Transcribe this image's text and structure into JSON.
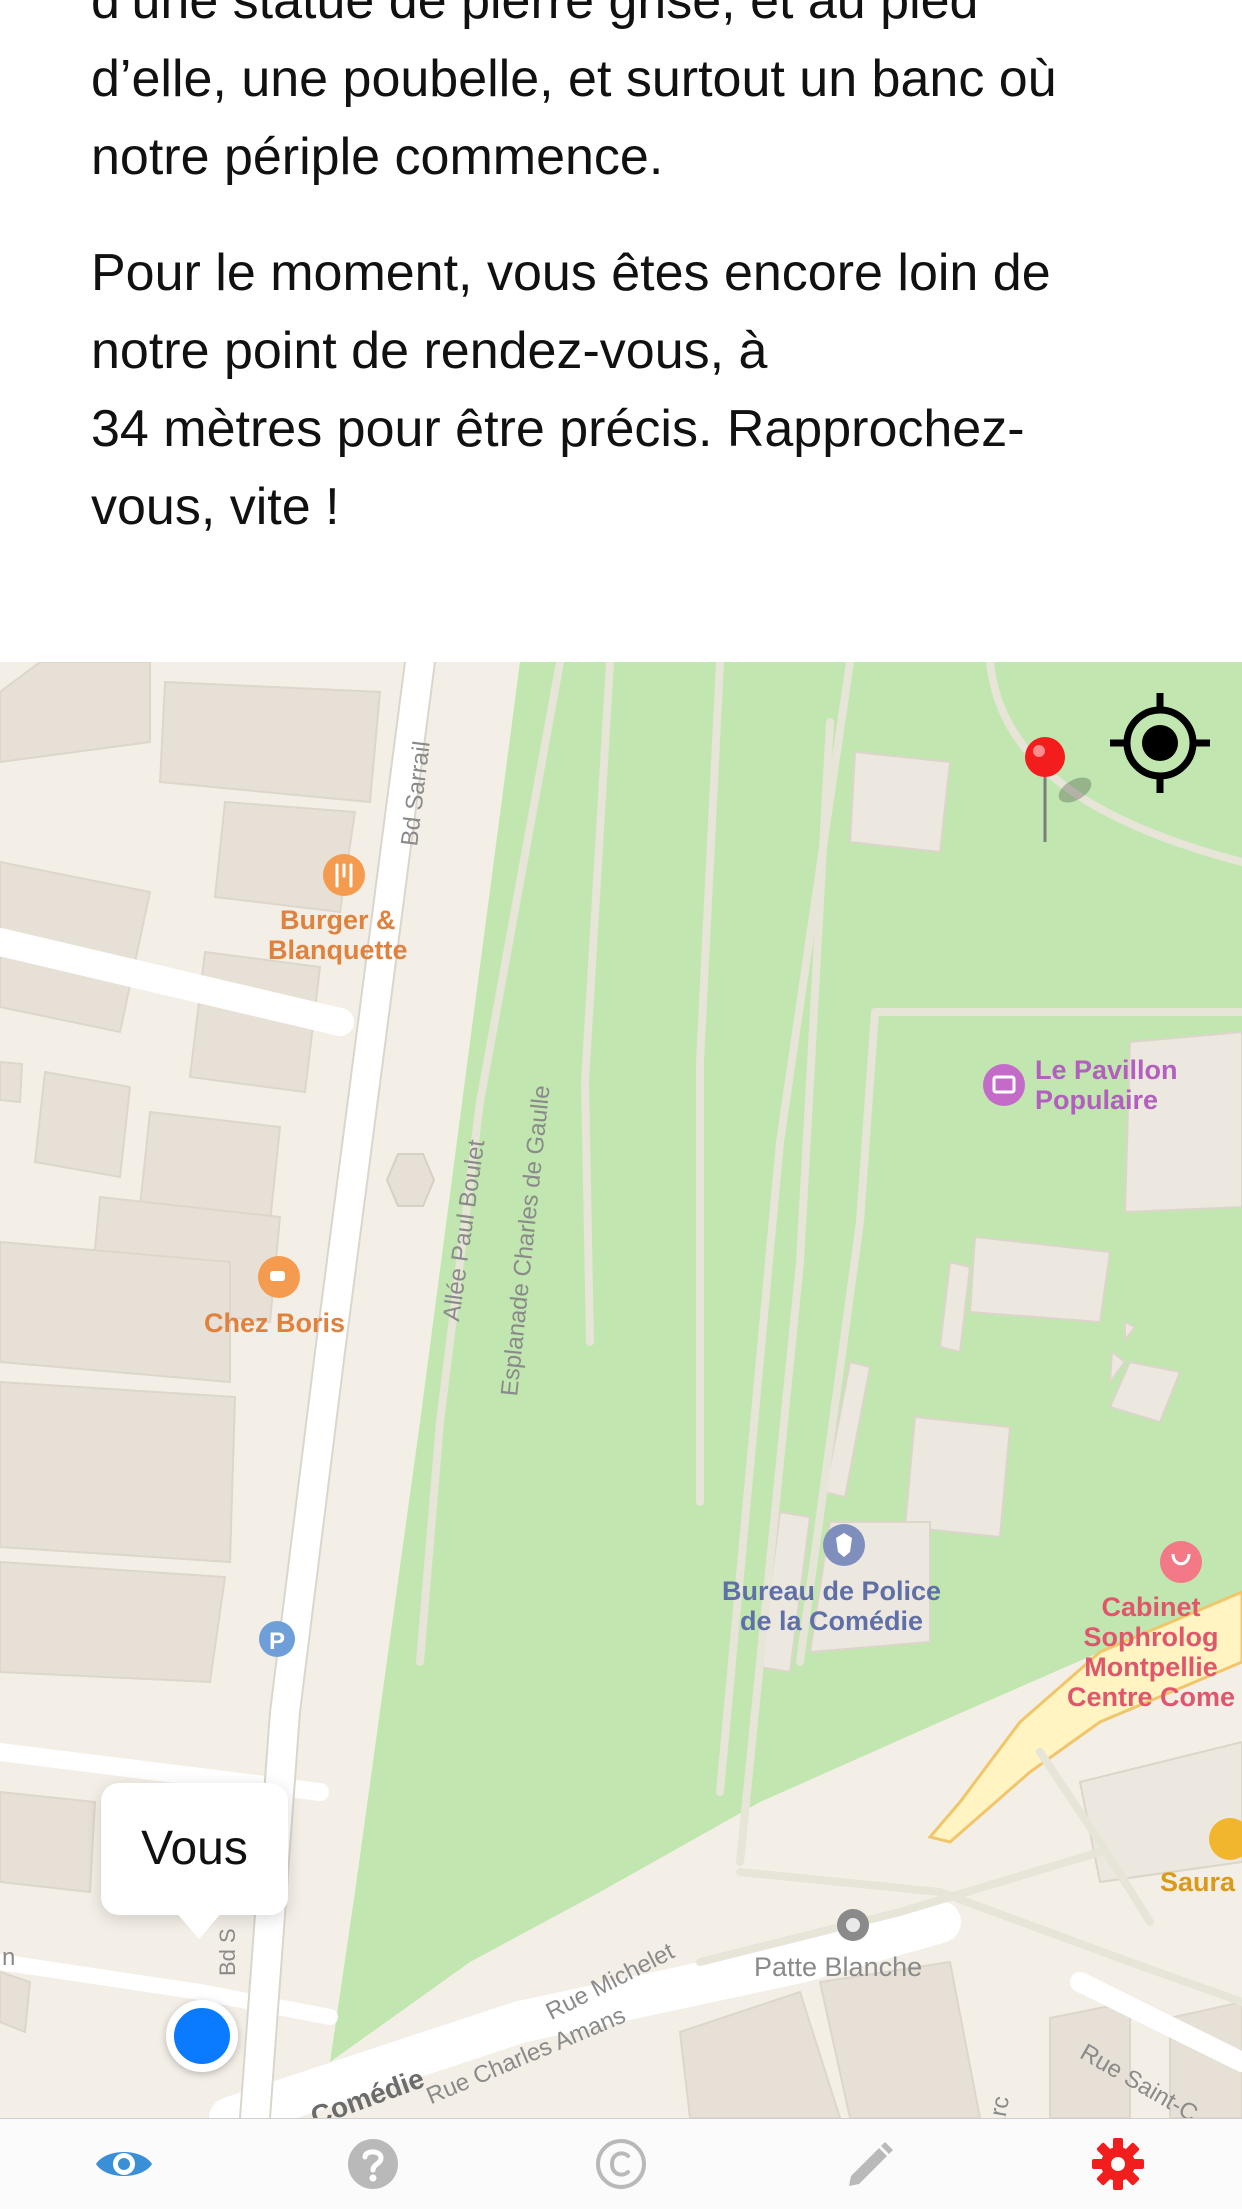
{
  "content": {
    "paragraph1": {
      "line0": "d’une statue de pierre grise, et au pied",
      "line1": "d’elle, une poubelle, et surtout un banc où",
      "line2": "notre périple commence."
    },
    "paragraph2": {
      "line1": "Pour le moment, vous êtes encore loin de",
      "line2": "notre point de rendez-vous, à",
      "line3": "34 mètres pour être précis. Rapprochez-",
      "line4": "vous, vite !"
    }
  },
  "map": {
    "user_callout": "Vous",
    "pois": {
      "burger": "Burger &\nBlanquette",
      "chez_boris": "Chez Boris",
      "pavillon": "Le Pavillon\nPopulaire",
      "police": "Bureau de Police\nde la Comédie",
      "cabinet": "Cabinet\nSophrolog\nMontpellie\nCentre Come",
      "saura": "Saura",
      "patte_blanche": "Patte Blanche"
    },
    "streets": {
      "bd_sarrail": "Bd Sarrail",
      "allee_boulet": "Allée Paul Boulet",
      "esplanade": "Esplanade Charles de Gaulle",
      "rue_michelet": "Rue Michelet",
      "rue_charles_amans": "Rue Charles Amans",
      "comedie": "Comédie",
      "rue_saint": "Rue Saint-C",
      "arc": "Arc",
      "bd_short": "Bd S",
      "n_edge": "n"
    },
    "colors": {
      "park": "#c1e6b0",
      "road": "#ffffff",
      "building": "#e6e0d6",
      "user_dot": "#0a7bff",
      "pin": "#f41d1d"
    },
    "icons": {
      "destination": "red-pin-icon",
      "locate": "crosshair-icon"
    }
  },
  "tabbar": {
    "tabs": [
      {
        "name": "eye-icon",
        "active": true,
        "color": "#3a8fd6"
      },
      {
        "name": "question-icon",
        "active": false,
        "color": "#b9b9b9"
      },
      {
        "name": "copyright-icon",
        "active": false,
        "color": "#b9b9b9"
      },
      {
        "name": "pencil-icon",
        "active": false,
        "color": "#b9b9b9"
      },
      {
        "name": "gear-icon",
        "active": true,
        "color": "#f21d1d"
      }
    ]
  }
}
